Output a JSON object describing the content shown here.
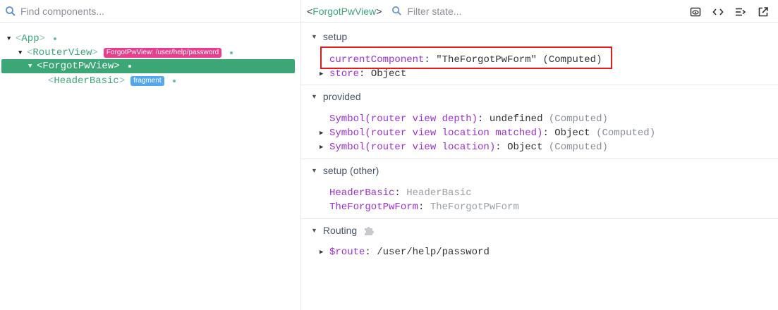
{
  "left": {
    "search_placeholder": "Find components...",
    "tree": [
      {
        "name": "App",
        "open_br": "<",
        "close_br": ">"
      },
      {
        "name": "RouterView",
        "open_br": "<",
        "close_br": ">",
        "badge": "ForgotPwView: /user/help/password"
      },
      {
        "name": "ForgotPwView",
        "open_br": "<",
        "close_br": ">",
        "selected": true
      },
      {
        "name": "HeaderBasic",
        "open_br": "<",
        "close_br": ">",
        "badge": "fragment"
      }
    ]
  },
  "right": {
    "component_title": {
      "open_br": "<",
      "name": "ForgotPwView",
      "close_br": ">"
    },
    "filter_placeholder": "Filter state...",
    "sections": {
      "setup": {
        "title": "setup",
        "props": [
          {
            "key": "currentComponent",
            "value": "\"TheForgotPwForm\"",
            "note": "(Computed)"
          },
          {
            "key": "store",
            "value": "Object"
          }
        ]
      },
      "provided": {
        "title": "provided",
        "props": [
          {
            "key": "Symbol(router view depth)",
            "value": "undefined",
            "note": "(Computed)"
          },
          {
            "key": "Symbol(router view location matched)",
            "value": "Object",
            "note": "(Computed)"
          },
          {
            "key": "Symbol(router view location)",
            "value": "Object",
            "note": "(Computed)"
          }
        ]
      },
      "setup_other": {
        "title": "setup (other)",
        "props": [
          {
            "key": "HeaderBasic",
            "value": "HeaderBasic"
          },
          {
            "key": "TheForgotPwForm",
            "value": "TheForgotPwForm"
          }
        ]
      },
      "routing": {
        "title": "Routing",
        "props": [
          {
            "key": "$route",
            "value": "/user/help/password"
          }
        ]
      }
    },
    "colon": ":",
    "expand_glyph": "▶",
    "collapse_glyph": "▼"
  },
  "colors": {
    "accent_green": "#3ba776",
    "badge_pink": "#e83e8c",
    "badge_blue": "#52a8f0",
    "key_purple": "#9b30d9",
    "highlight_red": "#e31b1b"
  }
}
